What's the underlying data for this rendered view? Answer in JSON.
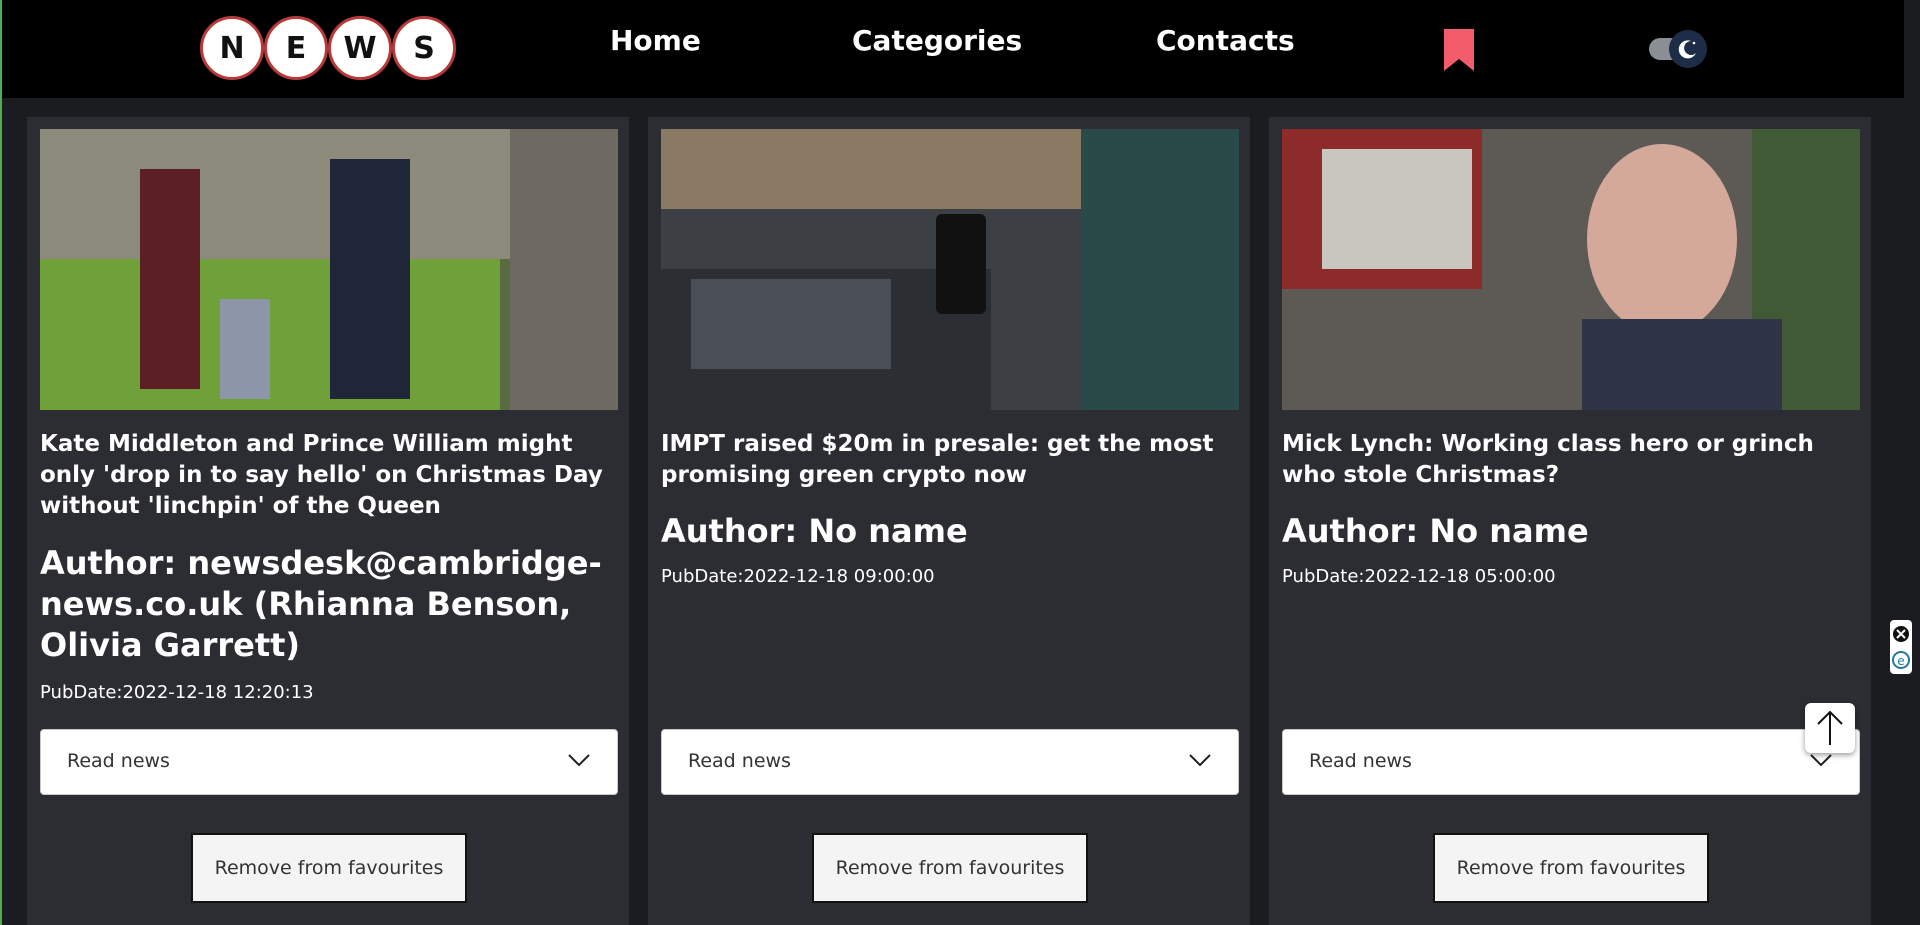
{
  "logo": {
    "letters": [
      "N",
      "E",
      "W",
      "S"
    ]
  },
  "nav": {
    "home": "Home",
    "categories": "Categories",
    "contacts": "Contacts"
  },
  "icons": {
    "bookmark": "bookmark-icon",
    "theme_toggle": "moon-icon",
    "scroll_top": "arrow-up-icon"
  },
  "colors": {
    "bookmark": "#f25c6b",
    "logo_border": "#b73a3a",
    "card_bg": "#2b2d33",
    "page_bg": "#1b1c20"
  },
  "cards": [
    {
      "title": "Kate Middleton and Prince William might only 'drop in to say hello' on Christmas Day without 'linchpin' of the Queen",
      "author": "Author: newsdesk@cambridge-news.co.uk (Rhianna Benson, Olivia Garrett)",
      "pubdate": "PubDate:2022-12-18 12:20:13",
      "read_label": "Read news",
      "remove_label": "Remove from favourites"
    },
    {
      "title": "IMPT raised $20m in presale: get the most promising green crypto now",
      "author": "Author: No name",
      "pubdate": "PubDate:2022-12-18 09:00:00",
      "read_label": "Read news",
      "remove_label": "Remove from favourites"
    },
    {
      "title": "Mick Lynch: Working class hero or grinch who stole Christmas?",
      "author": "Author: No name",
      "pubdate": "PubDate:2022-12-18 05:00:00",
      "read_label": "Read news",
      "remove_label": "Remove from favourites"
    }
  ]
}
